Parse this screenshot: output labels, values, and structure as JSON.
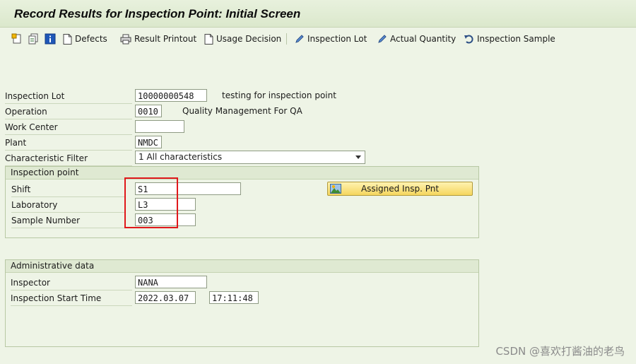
{
  "title": "Record Results for Inspection Point: Initial Screen",
  "toolbar": {
    "defects": "Defects",
    "result_printout": "Result Printout",
    "usage_decision": "Usage Decision",
    "inspection_lot": "Inspection Lot",
    "actual_quantity": "Actual Quantity",
    "inspection_sample": "Inspection Sample"
  },
  "fields": {
    "inspection_lot": {
      "label": "Inspection Lot",
      "value": "10000000548",
      "desc": "testing for inspection point"
    },
    "operation": {
      "label": "Operation",
      "value": "0010",
      "desc": "Quality Management For QA"
    },
    "work_center": {
      "label": "Work Center",
      "value": ""
    },
    "plant": {
      "label": "Plant",
      "value": "NMDC"
    },
    "characteristic_filter": {
      "label": "Characteristic Filter",
      "value": "1 All characteristics"
    }
  },
  "inspection_point": {
    "title": "Inspection point",
    "shift": {
      "label": "Shift",
      "value": "S1"
    },
    "laboratory": {
      "label": "Laboratory",
      "value": "L3"
    },
    "sample_number": {
      "label": "Sample Number",
      "value": "003"
    },
    "assigned_button": "Assigned Insp. Pnt"
  },
  "admin": {
    "title": "Administrative data",
    "inspector": {
      "label": "Inspector",
      "value": "NANA"
    },
    "start_time": {
      "label": "Inspection Start Time",
      "date": "2022.03.07",
      "time": "17:11:48"
    }
  },
  "watermark": "CSDN @喜欢打酱油的老鸟",
  "colors": {
    "highlight": "#e0181b",
    "background": "#eef4e6"
  }
}
